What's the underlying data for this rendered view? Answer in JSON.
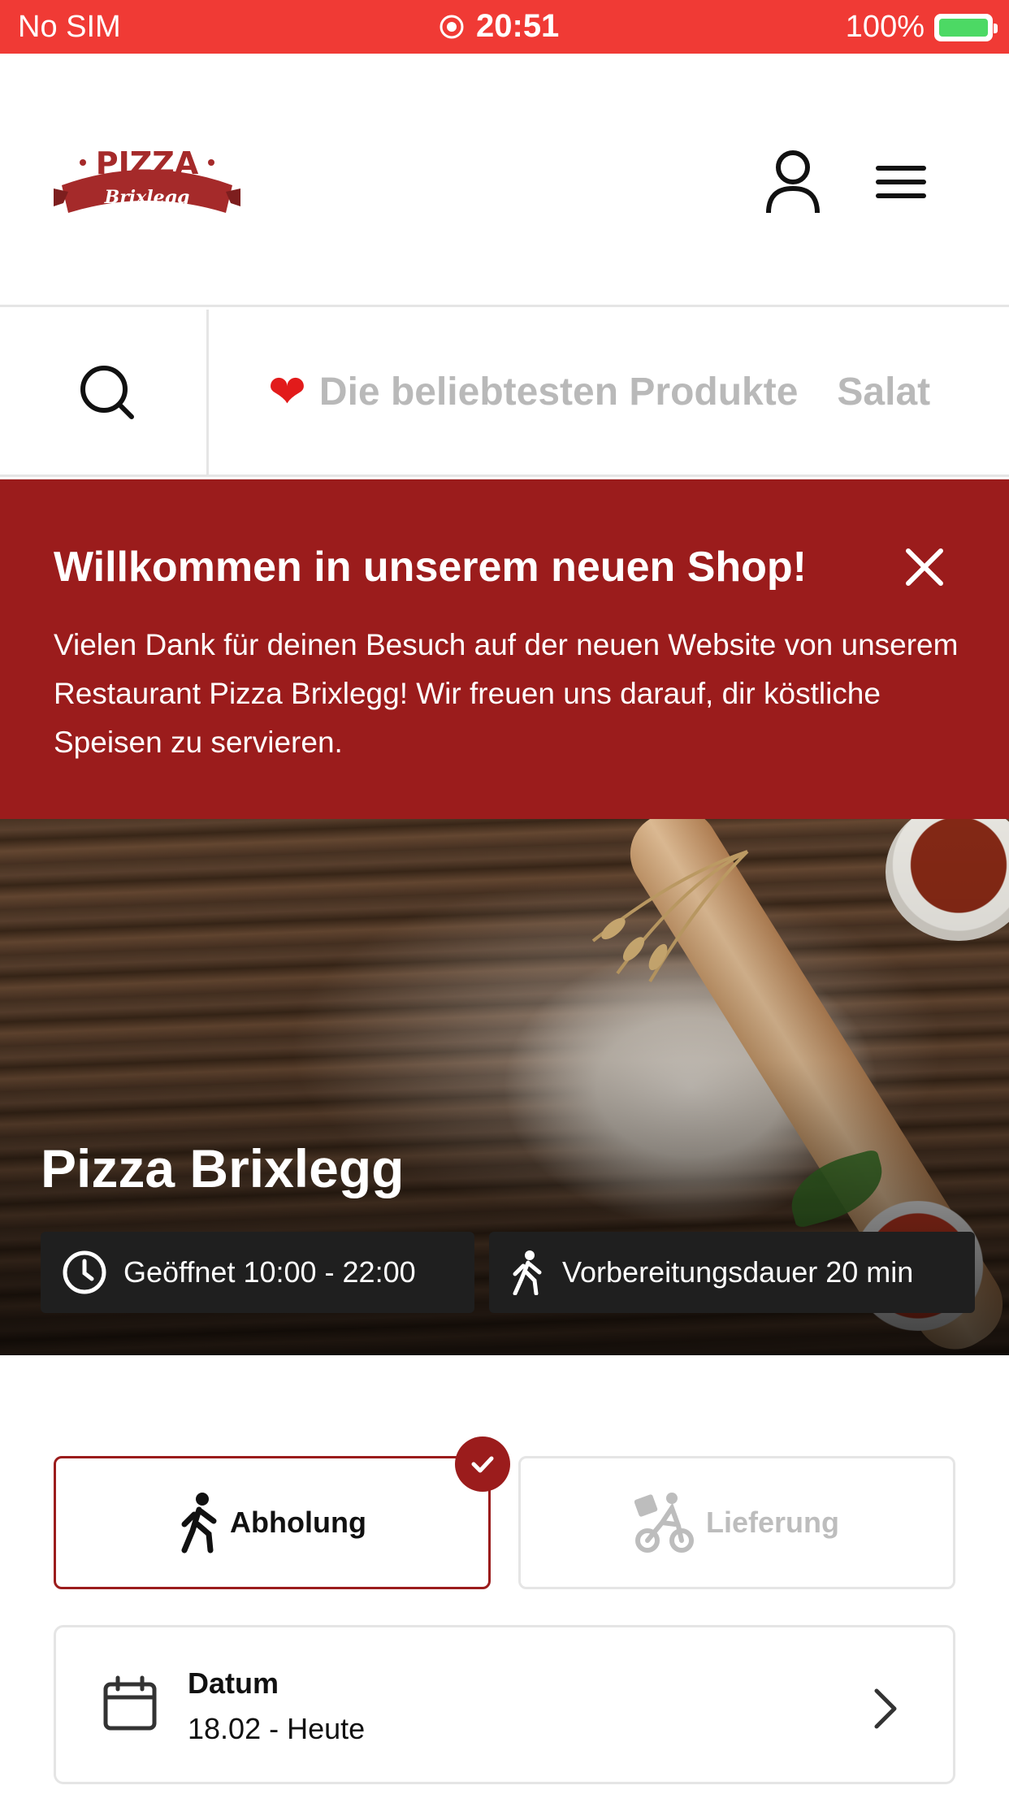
{
  "status_bar": {
    "carrier": "No SIM",
    "time": "20:51",
    "battery": "100%"
  },
  "header": {
    "logo_text_top": "PIZZA",
    "logo_text_bottom": "Brixlegg"
  },
  "nav": {
    "categories": [
      "Die beliebtesten Produkte",
      "Salat"
    ]
  },
  "banner": {
    "title": "Willkommen in unserem neuen Shop!",
    "text": "Vielen Dank für deinen Besuch auf der neuen Website von unserem Restaurant Pizza Brixlegg! Wir freuen uns darauf, dir köstliche Speisen zu servieren."
  },
  "hero": {
    "title": "Pizza Brixlegg",
    "opening_hours": "Geöffnet 10:00 - 22:00",
    "prep_time": "Vorbereitungsdauer 20 min"
  },
  "order_type": {
    "pickup_label": "Abholung",
    "delivery_label": "Lieferung",
    "selected": "Abholung"
  },
  "date": {
    "label": "Datum",
    "value": "18.02 - Heute"
  },
  "colors": {
    "status_bar": "#f03a35",
    "brand_red": "#9b1c1c",
    "muted": "#b9b9b9"
  }
}
